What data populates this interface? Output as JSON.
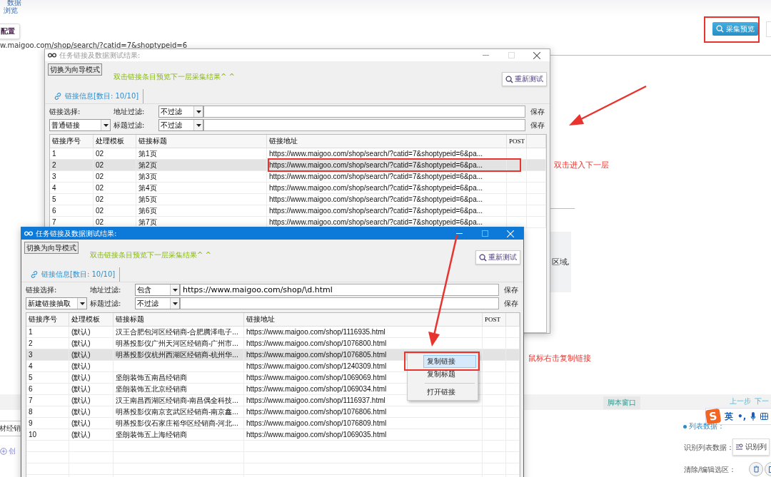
{
  "app": {
    "nav_label_1": "数据",
    "nav_label_2": "浏览",
    "config_button": "配置",
    "url": "w.maigoo.com/shop/search/?catid=7&shoptypeid=6",
    "preview_button": "采集预览",
    "side_text": "区域,",
    "left_cell": "材经销",
    "create_link": "创",
    "script_window": "脚本窗口",
    "prev_step": "上一步",
    "next_step": "下一",
    "ime_logo": "S",
    "ime_mode": "英",
    "ime_punct": "•,",
    "list_data_label": "列表数据：",
    "identify_label": "识别列表数据：",
    "identify_button": "识别列",
    "clear_label": "清除/编辑选区："
  },
  "windows": [
    {
      "title": "任务链接及数据测试结果:",
      "active": false,
      "mode_button": "切换为向导模式",
      "hint": "双击链接条目预览下一层采集结果^ ^",
      "retest_button": "重新测试",
      "tab": "链接信息[数目: 10/10]",
      "link_select_label": "链接选择:",
      "link_select_value": "普通链接",
      "address_filter_label": "地址过滤:",
      "address_filter_value": "不过滤",
      "title_filter_label": "标题过滤:",
      "title_filter_value": "不过滤",
      "save_1": "保存",
      "save_2": "保存",
      "columns": [
        "链接序号",
        "处理模板",
        "链接标题",
        "链接地址",
        "POST"
      ],
      "rows": [
        {
          "cells": [
            "1",
            "02",
            "第1页",
            "https://www.maigoo.com/shop/search/?catid=7&shoptypeid=6&pa..."
          ],
          "selected": false
        },
        {
          "cells": [
            "2",
            "02",
            "第2页",
            "https://www.maigoo.com/shop/search/?catid=7&shoptypeid=6&pa..."
          ],
          "selected": true
        },
        {
          "cells": [
            "3",
            "02",
            "第3页",
            "https://www.maigoo.com/shop/search/?catid=7&shoptypeid=6&pa..."
          ],
          "selected": false
        },
        {
          "cells": [
            "4",
            "02",
            "第4页",
            "https://www.maigoo.com/shop/search/?catid=7&shoptypeid=6&pa..."
          ],
          "selected": false
        },
        {
          "cells": [
            "5",
            "02",
            "第5页",
            "https://www.maigoo.com/shop/search/?catid=7&shoptypeid=6&pa..."
          ],
          "selected": false
        },
        {
          "cells": [
            "6",
            "02",
            "第6页",
            "https://www.maigoo.com/shop/search/?catid=7&shoptypeid=6&pa..."
          ],
          "selected": false
        },
        {
          "cells": [
            "7",
            "02",
            "第7页",
            "https://www.maigoo.com/shop/search/?catid=7&shoptypeid=6&pa..."
          ],
          "selected": false
        }
      ]
    },
    {
      "title": "任务链接及数据测试结果:",
      "active": true,
      "mode_button": "切换为向导模式",
      "hint": "双击链接条目预览下一层采集结果^ ^",
      "retest_button": "重新测试",
      "tab": "链接信息[数目: 10/10]",
      "link_select_label": "链接选择:",
      "link_select_value": "新建链接抽取",
      "address_filter_label": "地址过滤:",
      "address_filter_value": "包含",
      "address_input": "https://www.maigoo.com/shop/\\d.html",
      "title_filter_label": "标题过滤:",
      "title_filter_value": "不过滤",
      "save_1": "保存",
      "save_2": "保存",
      "columns": [
        "链接序号",
        "处理模板",
        "链接标题",
        "链接地址",
        "POST"
      ],
      "rows": [
        {
          "cells": [
            "1",
            "(默认)",
            "汉王合肥包河区经销商-合肥腾泽电子...",
            "https://www.maigoo.com/shop/1116935.html"
          ],
          "selected": false
        },
        {
          "cells": [
            "2",
            "(默认)",
            "明基投影仪广州天河区经销商-广州市...",
            "https://www.maigoo.com/shop/1076800.html"
          ],
          "selected": false
        },
        {
          "cells": [
            "3",
            "(默认)",
            "明基投影仪杭州西湖区经销商-杭州华...",
            "https://www.maigoo.com/shop/1076805.html"
          ],
          "selected": true
        },
        {
          "cells": [
            "4",
            "(默认)",
            "",
            "https://www.maigoo.com/shop/1240309.html"
          ],
          "selected": false
        },
        {
          "cells": [
            "5",
            "(默认)",
            "坚朗装饰五南昌经销商",
            "https://www.maigoo.com/shop/1069069.html"
          ],
          "selected": false
        },
        {
          "cells": [
            "6",
            "(默认)",
            "坚朗装饰五北京经销商",
            "https://www.maigoo.com/shop/1069034.html"
          ],
          "selected": false
        },
        {
          "cells": [
            "7",
            "(默认)",
            "汉王南昌西湖区经销商-南昌偶全科技...",
            "https://www.maigoo.com/shop/1116937.html"
          ],
          "selected": false
        },
        {
          "cells": [
            "8",
            "(默认)",
            "明基投影仪南京玄武区经销商-南京鑫...",
            "https://www.maigoo.com/shop/1076806.html"
          ],
          "selected": false
        },
        {
          "cells": [
            "9",
            "(默认)",
            "明基投影仪石家庄裕华区经销商-河北...",
            "https://www.maigoo.com/shop/1076809.html"
          ],
          "selected": false
        },
        {
          "cells": [
            "10",
            "(默认)",
            "坚朗装饰五上海经销商",
            "https://www.maigoo.com/shop/1069035.html"
          ],
          "selected": false
        }
      ],
      "context_menu": [
        {
          "kind": "item",
          "label": "复制链接",
          "selected": true
        },
        {
          "kind": "item",
          "label": "复制标题",
          "selected": false
        },
        {
          "kind": "separator"
        },
        {
          "kind": "item",
          "label": "打开链接",
          "selected": false
        }
      ]
    }
  ],
  "annotations": [
    {
      "text": "双击进入下一层"
    },
    {
      "text": "鼠标右击复制链接"
    }
  ]
}
